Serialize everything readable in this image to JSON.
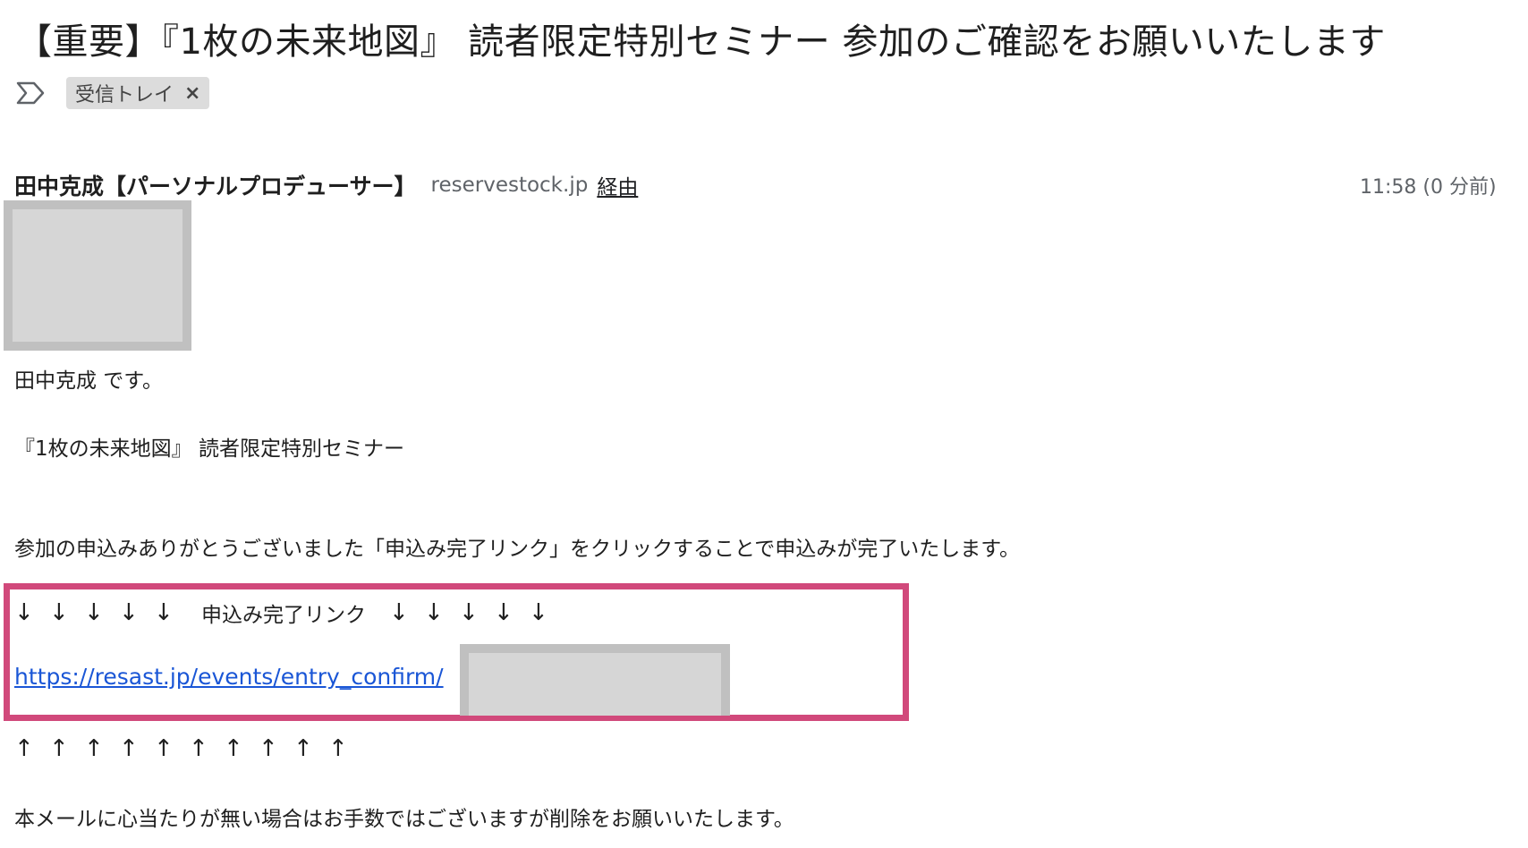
{
  "email": {
    "subject": "【重要】『1枚の未来地図』 読者限定特別セミナー 参加のご確認をお願いいたします",
    "label_chip": "受信トレイ",
    "label_chip_close": "×",
    "sender_name": "田中克成【パーソナルプロデューサー】",
    "sender_domain": "reservestock.jp",
    "sender_via": "経由",
    "time": "11:58 (0 分前)"
  },
  "body": {
    "greeting": "田中克成 です。",
    "seminar_title": "『1枚の未来地図』 読者限定特別セミナー",
    "instruction": "参加の申込みありがとうございました「申込み完了リンク」をクリックすることで申込みが完了いたします。",
    "down_arrow": "↓",
    "up_arrow": "↑",
    "link_caption": "申込み完了リンク",
    "confirm_link": "https://resast.jp/events/entry_confirm/",
    "footer": "本メールに心当たりが無い場合はお手数ではございますが削除をお願いいたします。"
  },
  "icons": {
    "important_marker": "important-label-icon",
    "chip_close": "close-icon",
    "more_options": "chevron-down-icon"
  },
  "colors": {
    "highlight_border": "#d1497b",
    "link": "#1a56d6",
    "chip_bg": "#dcdcdc",
    "redaction": "#d6d6d6"
  }
}
